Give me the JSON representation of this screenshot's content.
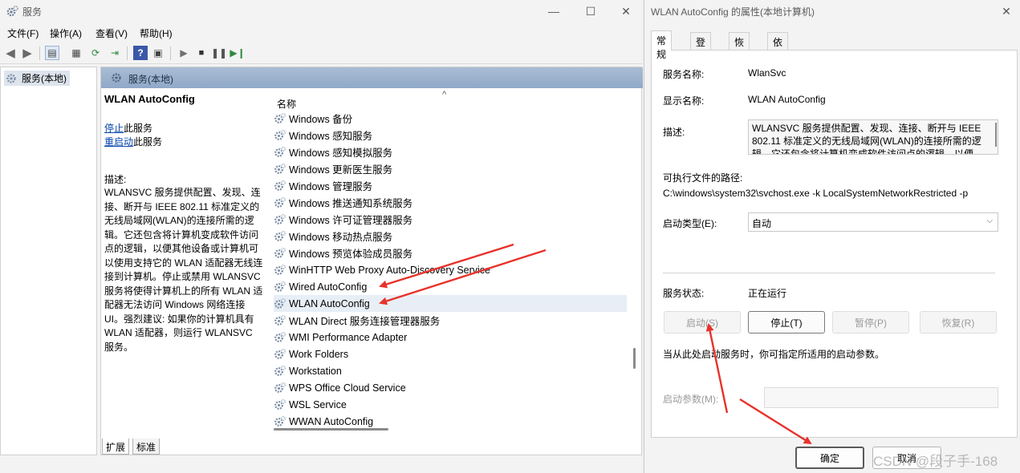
{
  "main": {
    "title": "服务",
    "menu": [
      "文件(F)",
      "操作(A)",
      "查看(V)",
      "帮助(H)"
    ],
    "tree_root": "服务(本地)",
    "content_header": "服务(本地)",
    "selected_service_title": "WLAN AutoConfig",
    "stop_link": "停止",
    "stop_suffix": "此服务",
    "restart_link": "重启动",
    "restart_suffix": "此服务",
    "desc_label": "描述:",
    "desc_text": "WLANSVC 服务提供配置、发现、连接、断开与 IEEE 802.11 标准定义的无线局域网(WLAN)的连接所需的逻辑。它还包含将计算机变成软件访问点的逻辑，以便其他设备或计算机可以使用支持它的 WLAN 适配器无线连接到计算机。停止或禁用 WLANSVC 服务将使得计算机上的所有 WLAN 适配器无法访问 Windows 网络连接 UI。强烈建议: 如果你的计算机具有 WLAN 适配器，则运行 WLANSVC 服务。",
    "column_name": "名称",
    "services": [
      "Windows 备份",
      "Windows 感知服务",
      "Windows 感知模拟服务",
      "Windows 更新医生服务",
      "Windows 管理服务",
      "Windows 推送通知系统服务",
      "Windows 许可证管理器服务",
      "Windows 移动热点服务",
      "Windows 预览体验成员服务",
      "WinHTTP Web Proxy Auto-Discovery Service",
      "Wired AutoConfig",
      "WLAN AutoConfig",
      "WLAN Direct 服务连接管理器服务",
      "WMI Performance Adapter",
      "Work Folders",
      "Workstation",
      "WPS Office Cloud Service",
      "WSL Service",
      "WWAN AutoConfig"
    ],
    "selected_index": 11,
    "bottom_tabs": [
      "扩展",
      "标准"
    ]
  },
  "dialog": {
    "title": "WLAN AutoConfig 的属性(本地计算机)",
    "tabs": [
      "常规",
      "登录",
      "恢复",
      "依存关系"
    ],
    "service_name_label": "服务名称:",
    "service_name": "WlanSvc",
    "display_name_label": "显示名称:",
    "display_name": "WLAN AutoConfig",
    "desc_label": "描述:",
    "desc_text": "WLANSVC 服务提供配置、发现、连接、断开与 IEEE 802.11 标准定义的无线局域网(WLAN)的连接所需的逻辑。它还包含将计算机变成软件访问点的逻辑，以便",
    "path_label": "可执行文件的路径:",
    "path_value": "C:\\windows\\system32\\svchost.exe -k LocalSystemNetworkRestricted -p",
    "startup_type_label": "启动类型(E):",
    "startup_type_value": "自动",
    "status_label": "服务状态:",
    "status_value": "正在运行",
    "btn_start": "启动(S)",
    "btn_stop": "停止(T)",
    "btn_pause": "暂停(P)",
    "btn_resume": "恢复(R)",
    "hint": "当从此处启动服务时，你可指定所适用的启动参数。",
    "param_label": "启动参数(M):",
    "param_value": "",
    "btn_ok": "确定",
    "btn_cancel": "取消"
  },
  "watermark": "CSDN @段子手-168",
  "colors": {
    "arrow": "#e8322a",
    "header": "#9fb4cf",
    "link": "#0645ad"
  }
}
